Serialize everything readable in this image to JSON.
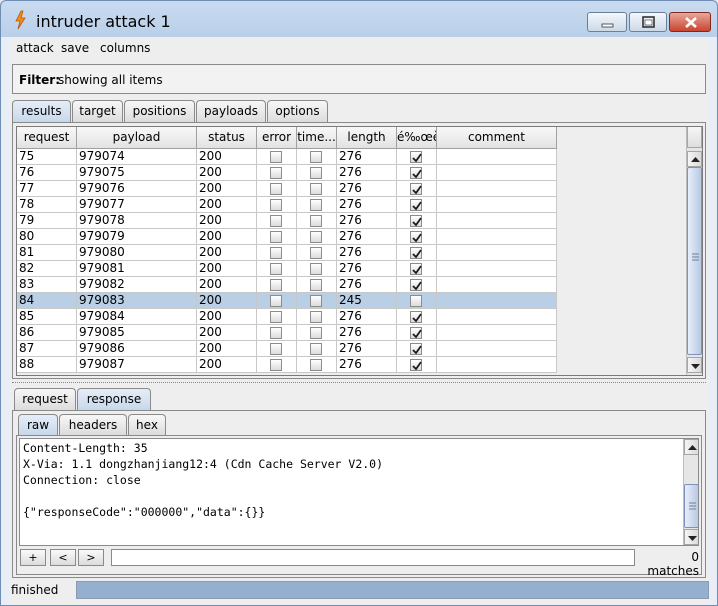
{
  "window": {
    "title": "intruder attack 1"
  },
  "menu": [
    "attack",
    "save",
    "columns"
  ],
  "filter": {
    "label": "Filter:",
    "value": "showing all items"
  },
  "tabs": [
    "results",
    "target",
    "positions",
    "payloads",
    "options"
  ],
  "active_tab": "results",
  "table": {
    "columns": [
      "request",
      "payload",
      "status",
      "error",
      "time...",
      "length",
      "é‰œè...",
      "comment"
    ],
    "rows": [
      {
        "request": "75",
        "payload": "979074",
        "status": "200",
        "error": false,
        "timeout": false,
        "length": "276",
        "match": true
      },
      {
        "request": "76",
        "payload": "979075",
        "status": "200",
        "error": false,
        "timeout": false,
        "length": "276",
        "match": true
      },
      {
        "request": "77",
        "payload": "979076",
        "status": "200",
        "error": false,
        "timeout": false,
        "length": "276",
        "match": true
      },
      {
        "request": "78",
        "payload": "979077",
        "status": "200",
        "error": false,
        "timeout": false,
        "length": "276",
        "match": true
      },
      {
        "request": "79",
        "payload": "979078",
        "status": "200",
        "error": false,
        "timeout": false,
        "length": "276",
        "match": true
      },
      {
        "request": "80",
        "payload": "979079",
        "status": "200",
        "error": false,
        "timeout": false,
        "length": "276",
        "match": true
      },
      {
        "request": "81",
        "payload": "979080",
        "status": "200",
        "error": false,
        "timeout": false,
        "length": "276",
        "match": true
      },
      {
        "request": "82",
        "payload": "979081",
        "status": "200",
        "error": false,
        "timeout": false,
        "length": "276",
        "match": true
      },
      {
        "request": "83",
        "payload": "979082",
        "status": "200",
        "error": false,
        "timeout": false,
        "length": "276",
        "match": true
      },
      {
        "request": "84",
        "payload": "979083",
        "status": "200",
        "error": false,
        "timeout": false,
        "length": "245",
        "match": false,
        "selected": true
      },
      {
        "request": "85",
        "payload": "979084",
        "status": "200",
        "error": false,
        "timeout": false,
        "length": "276",
        "match": true
      },
      {
        "request": "86",
        "payload": "979085",
        "status": "200",
        "error": false,
        "timeout": false,
        "length": "276",
        "match": true
      },
      {
        "request": "87",
        "payload": "979086",
        "status": "200",
        "error": false,
        "timeout": false,
        "length": "276",
        "match": true
      },
      {
        "request": "88",
        "payload": "979087",
        "status": "200",
        "error": false,
        "timeout": false,
        "length": "276",
        "match": true
      }
    ]
  },
  "bottom_tabs": [
    "request",
    "response"
  ],
  "bottom_active": "response",
  "sub_tabs": [
    "raw",
    "headers",
    "hex"
  ],
  "sub_active": "raw",
  "response_lines": [
    "Content-Length: 35",
    "X-Via: 1.1 dongzhanjiang12:4 (Cdn Cache Server V2.0)",
    "Connection: close",
    "",
    "{\"responseCode\":\"000000\",\"data\":{}}"
  ],
  "search_buttons": [
    "+",
    "<",
    ">"
  ],
  "search": {
    "value": "",
    "matches": "0 matches"
  },
  "status": {
    "text": "finished",
    "progress": 1.0
  },
  "colors": {
    "selected_row": "#b8cfe5",
    "progress": "#94b0ce",
    "title_bar": "#c9dbf0"
  }
}
